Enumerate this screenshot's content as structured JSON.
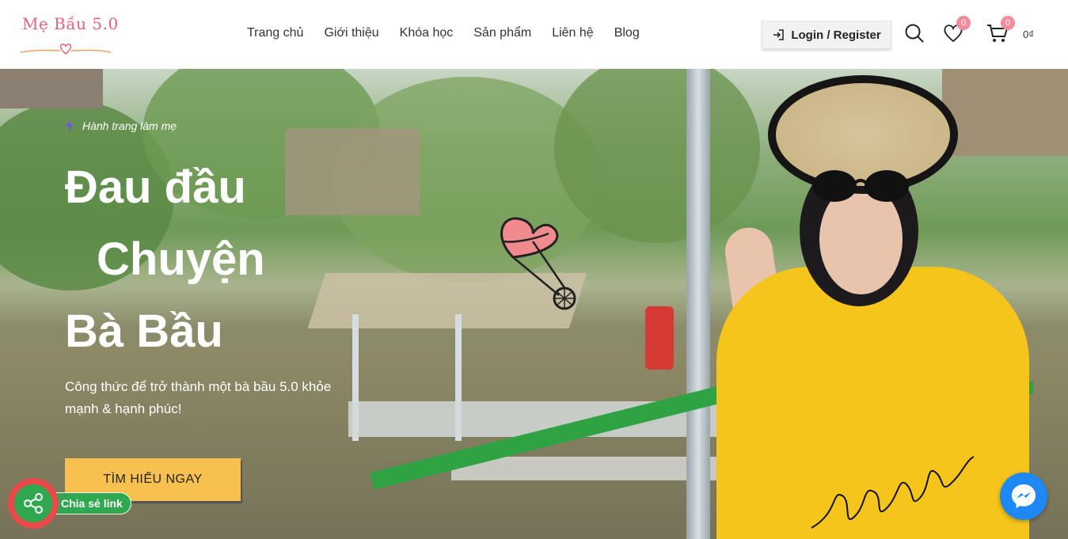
{
  "logo": {
    "text": "Mẹ Bầu 5.0"
  },
  "nav": {
    "items": [
      {
        "label": "Trang chủ"
      },
      {
        "label": "Giới thiệu"
      },
      {
        "label": "Khóa học"
      },
      {
        "label": "Sản phẩm"
      },
      {
        "label": "Liên hệ"
      },
      {
        "label": "Blog"
      }
    ]
  },
  "header_actions": {
    "login_label": "Login / Register",
    "wishlist_count": "0",
    "cart_count": "0",
    "cart_total": "0₫"
  },
  "hero": {
    "eyebrow": "Hành trang làm mẹ",
    "title_line1": "Đau đầu",
    "title_line2": "Chuyện",
    "title_line3": "Bà Bầu",
    "subtitle": "Công thức để trở thành một bà bầu 5.0 khỏe mạnh & hạnh phúc!",
    "cta_label": "TÌM HIỂU NGAY"
  },
  "share": {
    "label": "Chia sẻ link"
  },
  "colors": {
    "accent": "#f8c14f",
    "brand_pink": "#e8607a",
    "badge": "#f28b9a",
    "share_green": "#2fa84f",
    "messenger_blue": "#1e88f5"
  }
}
